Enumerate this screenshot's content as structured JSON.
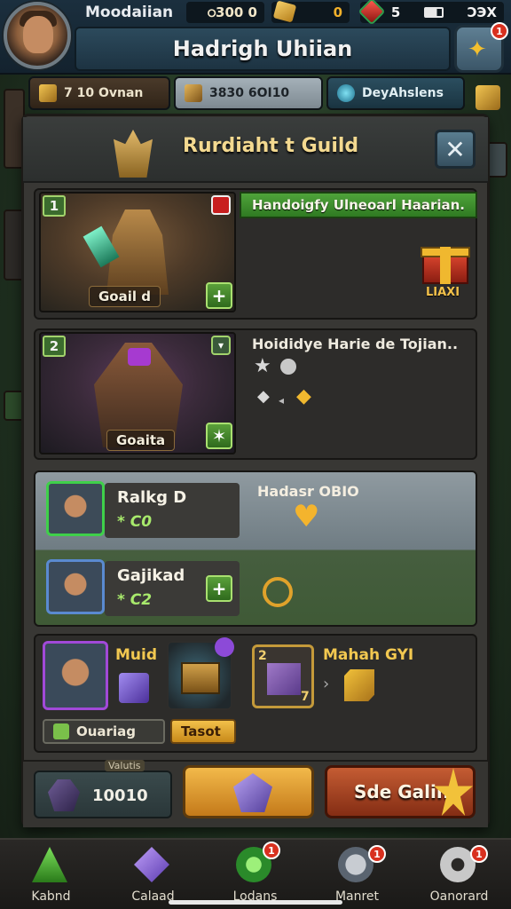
{
  "header": {
    "player_name": "Moodaiian",
    "stat_a": "ഠ300 0",
    "stat_b": "0",
    "stat_c_left": "5",
    "stat_c_right": "ϽЭX",
    "title": "Hadrigh Uhiian",
    "corner_badge": "1"
  },
  "tabs": [
    {
      "label": "7 10 Ovnan"
    },
    {
      "label": "3830 6OI10"
    },
    {
      "label": "DeyAhslens"
    }
  ],
  "panel": {
    "title": "Rurdiaht t Guild",
    "close_label": "✕"
  },
  "hero1": {
    "rank": "1",
    "name": "Goail d",
    "banner": "Handoigfy Ulneoarl Haarian.",
    "reward_label": "LIAXI"
  },
  "hero2": {
    "rank": "2",
    "name": "Goaita",
    "line": "Hoididye Harie de Tojian.."
  },
  "members": {
    "stat_label": "Hadasr OBIO",
    "m1": {
      "name": "Ralkg D",
      "score": "* C0"
    },
    "m2": {
      "name": "Gajikad",
      "score": "* C2"
    }
  },
  "loot": {
    "item1_label": "Muid",
    "item3_rank": "2",
    "item3_count": "7",
    "item3_name": "Mahah GYI",
    "btn_left": "Ouariag",
    "btn_right": "Tasot"
  },
  "bottom": {
    "caption": "Valutis",
    "currency_value": "10010",
    "action_label": "Sde Galin"
  },
  "navbar": [
    {
      "label": "Kabnd",
      "badge": ""
    },
    {
      "label": "Calaad",
      "badge": ""
    },
    {
      "label": "Lodans",
      "badge": "1"
    },
    {
      "label": "Manret",
      "badge": "1"
    },
    {
      "label": "Oanorard",
      "badge": "1"
    }
  ],
  "colors": {
    "accent_gold": "#f2c23a",
    "banner_green": "#4fa33a",
    "panel_bg": "#383734",
    "action_red": "#c45c33"
  }
}
